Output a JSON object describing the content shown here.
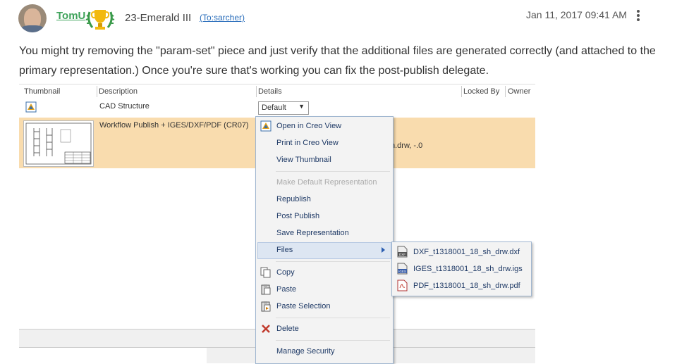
{
  "post": {
    "username": "TomU",
    "rank": "23-Emerald III",
    "to_link": "(To:sarcher)",
    "timestamp": "Jan 11, 2017 09:41 AM",
    "body": "You might try removing the \"param-set\" piece and just verify that the additional files are generated correctly (and attached to the primary representation.)  Once you're sure that's working you can fix the post-publish delegate."
  },
  "table": {
    "columns": [
      "Thumbnail",
      "Description",
      "Details",
      "Locked By",
      "Owner"
    ],
    "rows": [
      {
        "description": "CAD Structure",
        "details_select": "Default"
      },
      {
        "description": "Workflow Publish + IGES/DXF/PDF (CR07)",
        "details_fragment": "h.drw, -.0"
      }
    ]
  },
  "context_menu": {
    "items": [
      {
        "label": "Open in Creo View",
        "icon": "creo-view-icon",
        "enabled": true
      },
      {
        "label": "Print in Creo View",
        "enabled": true
      },
      {
        "label": "View Thumbnail",
        "enabled": true
      },
      {
        "label": "Make Default Representation",
        "enabled": false
      },
      {
        "label": "Republish",
        "enabled": true
      },
      {
        "label": "Post Publish",
        "enabled": true
      },
      {
        "label": "Save Representation",
        "enabled": true
      },
      {
        "label": "Files",
        "enabled": true,
        "submenu": true,
        "highlighted": true
      },
      {
        "label": "Copy",
        "icon": "copy-icon",
        "enabled": true
      },
      {
        "label": "Paste",
        "icon": "paste-icon",
        "enabled": true
      },
      {
        "label": "Paste Selection",
        "icon": "paste-selection-icon",
        "enabled": true
      },
      {
        "label": "Delete",
        "icon": "delete-icon",
        "enabled": true
      },
      {
        "label": "Manage Security",
        "enabled": true
      }
    ]
  },
  "files_submenu": {
    "items": [
      {
        "label": "DXF_t1318001_18_sh_drw.dxf",
        "icon": "dxf-file-icon"
      },
      {
        "label": "IGES_t1318001_18_sh_drw.igs",
        "icon": "iges-file-icon"
      },
      {
        "label": "PDF_t1318001_18_sh_drw.pdf",
        "icon": "pdf-file-icon"
      }
    ]
  },
  "colors": {
    "username": "#3fa35b",
    "link": "#2a6ebb",
    "selected_row": "#f9dcae",
    "menu_text": "#1f3a66",
    "delete_icon": "#c0392b"
  }
}
